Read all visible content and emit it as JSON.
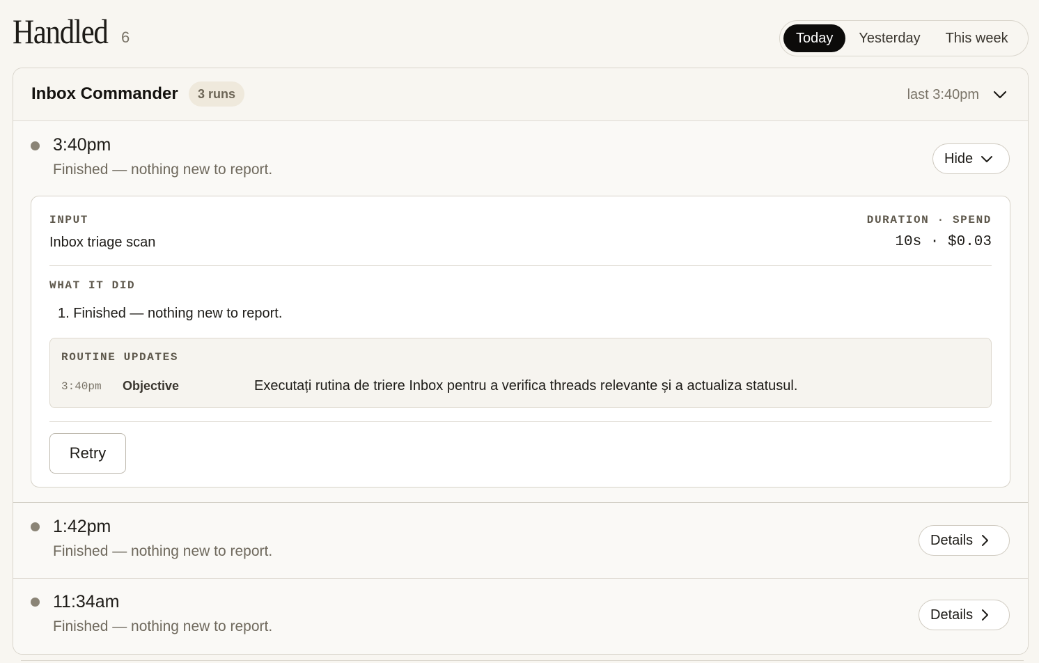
{
  "header": {
    "title": "Handled",
    "count": "6",
    "range_tabs": [
      {
        "label": "Today",
        "active": true
      },
      {
        "label": "Yesterday",
        "active": false
      },
      {
        "label": "This week",
        "active": false
      }
    ]
  },
  "routine": {
    "name": "Inbox Commander",
    "runs_badge": "3 runs",
    "last_run": "last 3:40pm",
    "runs": [
      {
        "time": "3:40pm",
        "summary": "Finished — nothing new to report.",
        "toggle_label": "Hide",
        "details": {
          "input_label": "INPUT",
          "input_value": "Inbox triage scan",
          "duration_spend_label": "DURATION · SPEND",
          "duration_spend_value": "10s · $0.03",
          "what_it_did_label": "WHAT IT DID",
          "steps": [
            "1. Finished — nothing new to report."
          ],
          "routine_updates_label": "ROUTINE UPDATES",
          "updates": [
            {
              "time": "3:40pm",
              "field": "Objective",
              "value": "Executați rutina de triere Inbox pentru a verifica threads relevante și a actualiza statusul."
            }
          ],
          "retry_label": "Retry"
        }
      },
      {
        "time": "1:42pm",
        "summary": "Finished — nothing new to report.",
        "toggle_label": "Details"
      },
      {
        "time": "11:34am",
        "summary": "Finished — nothing new to report.",
        "toggle_label": "Details"
      }
    ]
  },
  "colors": {
    "background": "#f8f6f1",
    "active_tab": "#0c0b0a",
    "badge_bg": "#efe9dc",
    "status_dot": "#8a8476"
  }
}
